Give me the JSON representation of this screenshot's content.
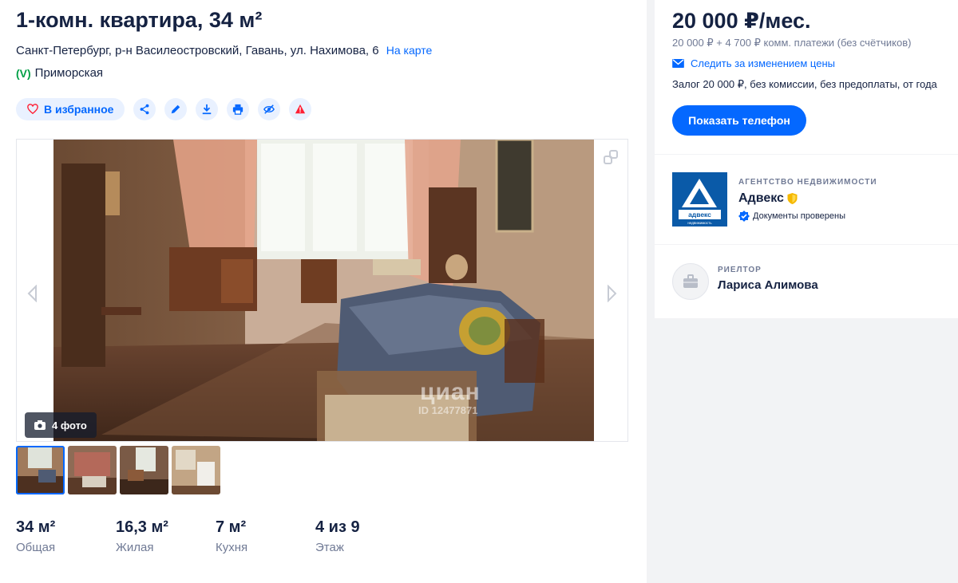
{
  "listing": {
    "title": "1-комн. квартира, 34 м²",
    "address": "Санкт-Петербург, р-н Василеостровский, Гавань, ул. Нахимова, 6",
    "map_link": "На карте",
    "metro": "Приморская"
  },
  "actions": {
    "favorite_label": "В избранное",
    "icons": [
      "share-icon",
      "edit-icon",
      "download-icon",
      "print-icon",
      "hide-icon",
      "warning-icon"
    ]
  },
  "gallery": {
    "photo_count": "4 фото",
    "watermark": "циан",
    "watermark_id": "ID 12477871",
    "thumbnail_count": 4
  },
  "stats": [
    {
      "value": "34 м²",
      "label": "Общая"
    },
    {
      "value": "16,3 м²",
      "label": "Жилая"
    },
    {
      "value": "7 м²",
      "label": "Кухня"
    },
    {
      "value": "4 из 9",
      "label": "Этаж"
    }
  ],
  "price": {
    "main": "20 000 ₽/мес.",
    "sub": "20 000 ₽ + 4 700 ₽ комм. платежи (без счётчиков)",
    "watch_label": "Следить за изменением цены",
    "terms": "Залог 20 000 ₽, без комиссии, без предоплаты, от года",
    "phone_button": "Показать телефон"
  },
  "agency": {
    "kicker": "АГЕНТСТВО НЕДВИЖИМОСТИ",
    "name": "Адвекс",
    "verified": "Документы проверены",
    "logo_text": "адвекс",
    "logo_subtext": "недвижимость"
  },
  "agent": {
    "kicker": "РИЕЛТОР",
    "name": "Лариса Алимова"
  },
  "colors": {
    "accent": "#0468ff",
    "text": "#152242",
    "muted": "#707a95",
    "metro": "#00a046",
    "warning": "#ff1f34"
  }
}
